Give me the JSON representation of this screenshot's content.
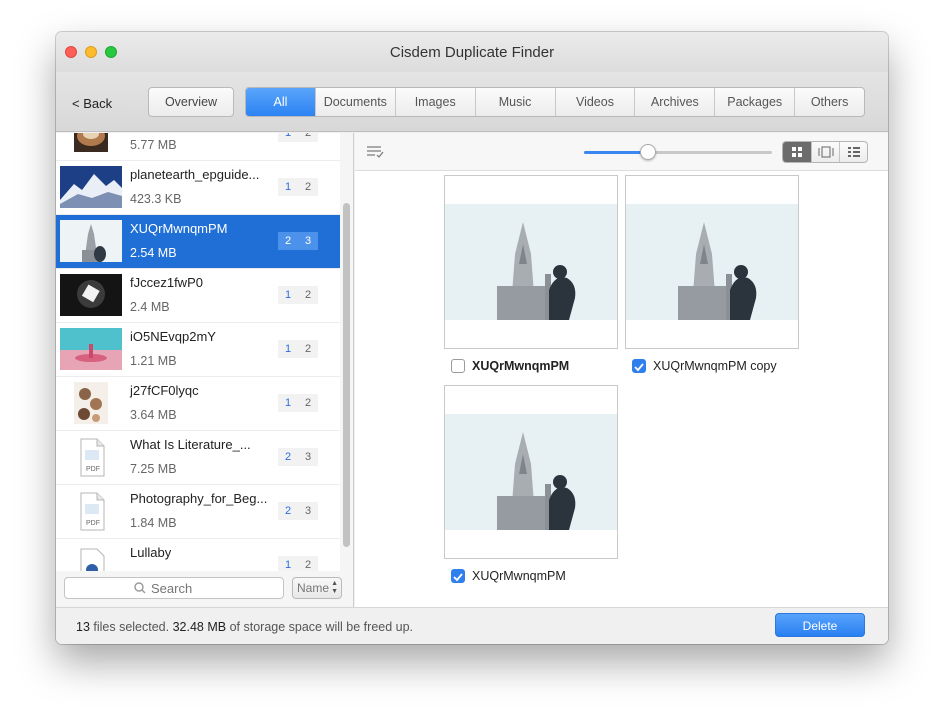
{
  "window": {
    "title": "Cisdem Duplicate Finder"
  },
  "toolbar": {
    "back_label": "< Back",
    "overview_label": "Overview",
    "tabs": [
      {
        "label": "All",
        "active": true
      },
      {
        "label": "Documents"
      },
      {
        "label": "Images"
      },
      {
        "label": "Music"
      },
      {
        "label": "Videos"
      },
      {
        "label": "Archives"
      },
      {
        "label": "Packages"
      },
      {
        "label": "Others"
      }
    ]
  },
  "sidebar": {
    "items": [
      {
        "name": "",
        "size": "5.77 MB",
        "count_a": "1",
        "count_b": "2",
        "thumb": "photo-food"
      },
      {
        "name": "planetearth_epguide...",
        "size": "423.3 KB",
        "count_a": "1",
        "count_b": "2",
        "thumb": "photo-mountain"
      },
      {
        "name": "XUQrMwnqmPM",
        "size": "2.54 MB",
        "count_a": "2",
        "count_b": "3",
        "thumb": "photo-church",
        "selected": true
      },
      {
        "name": "fJccez1fwP0",
        "size": "2.4 MB",
        "count_a": "1",
        "count_b": "2",
        "thumb": "photo-light"
      },
      {
        "name": "iO5NEvqp2mY",
        "size": "1.21 MB",
        "count_a": "1",
        "count_b": "2",
        "thumb": "photo-drop"
      },
      {
        "name": "j27fCF0lyqc",
        "size": "3.64 MB",
        "count_a": "1",
        "count_b": "2",
        "thumb": "photo-cookies"
      },
      {
        "name": "What Is Literature_...",
        "size": "7.25 MB",
        "count_a": "2",
        "count_b": "3",
        "thumb": "pdf-icon"
      },
      {
        "name": "Photography_for_Beg...",
        "size": "1.84 MB",
        "count_a": "2",
        "count_b": "3",
        "thumb": "pdf-icon"
      },
      {
        "name": "Lullaby",
        "size": "",
        "count_a": "1",
        "count_b": "2",
        "thumb": "audio-file-icon"
      }
    ],
    "search_placeholder": "Search",
    "sort_label": "Name"
  },
  "main": {
    "cards": [
      {
        "label": "XUQrMwnqmPM",
        "checked": false,
        "bold": true
      },
      {
        "label": "XUQrMwnqmPM copy",
        "checked": true,
        "bold": false
      },
      {
        "label": "XUQrMwnqmPM",
        "checked": true,
        "bold": false
      }
    ]
  },
  "status": {
    "count": "13",
    "text1": " files selected. ",
    "size": "32.48 MB",
    "text2": " of storage space will be freed up.",
    "delete_label": "Delete"
  },
  "colors": {
    "accent": "#2d83f3",
    "selected_row": "#1f6fd6"
  }
}
